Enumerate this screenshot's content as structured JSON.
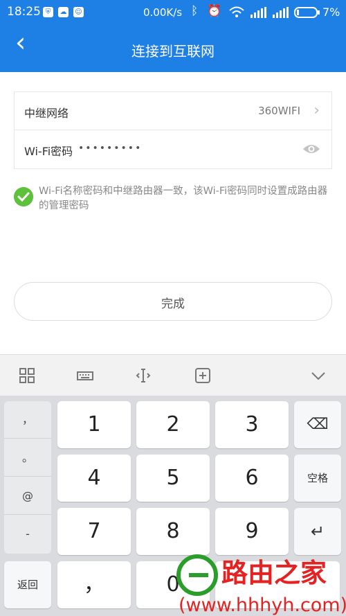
{
  "status": {
    "time": "18:25",
    "app_icons": [
      "shield-app-icon",
      "cloud-app-icon",
      "android-app-icon"
    ],
    "net_speed": "0.00K/s",
    "battery": "7%"
  },
  "header": {
    "title": "连接到互联网",
    "back": "‹"
  },
  "form": {
    "relay_label": "中继网络",
    "relay_value": "360WIFI",
    "pw_label": "Wi-Fi密码",
    "pw_value": "•••••••••"
  },
  "agree_text": "Wi-Fi名称密码和中继路由器一致，该Wi-Fi密码同时设置成路由器的管理密码",
  "done_label": "完成",
  "keyboard": {
    "symbols": [
      "，",
      "。",
      "@",
      "-"
    ],
    "digits": [
      "1",
      "2",
      "3",
      "4",
      "5",
      "6",
      "7",
      "8",
      "9",
      "，",
      "0"
    ],
    "space_label": "空格",
    "back_label": "返回",
    "enter": "↵",
    "delete": "⌫"
  },
  "watermark": {
    "brand": "路由之家",
    "url": "(www.hhhyh.com)"
  },
  "colors": {
    "primary": "#1e7fe5",
    "check": "#5ec13c",
    "watermark": "#e52222"
  }
}
